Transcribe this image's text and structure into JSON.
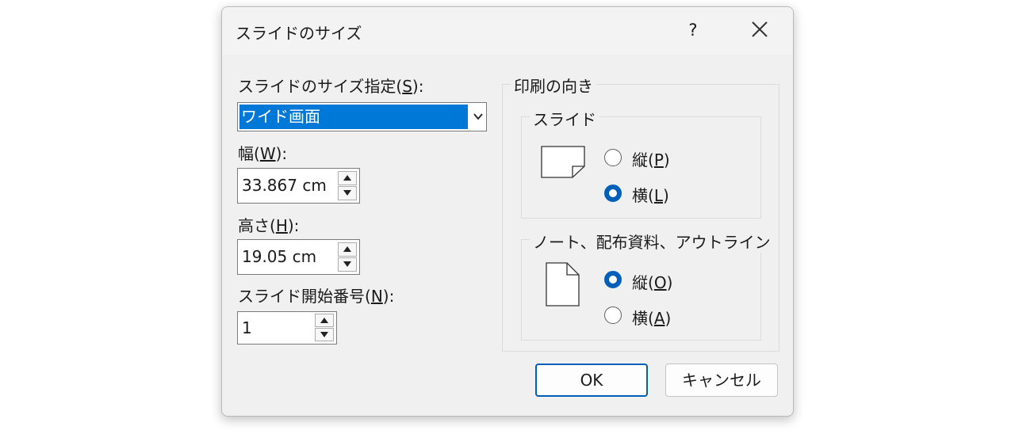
{
  "dialog": {
    "title": "スライドのサイズ",
    "help_label": "?"
  },
  "size": {
    "label_text": "スライドのサイズ指定(",
    "label_key": "S",
    "label_tail": "):",
    "selected": "ワイド画面"
  },
  "width": {
    "label_text": "幅(",
    "label_key": "W",
    "label_tail": "):",
    "value": "33.867 cm"
  },
  "height": {
    "label_text": "高さ(",
    "label_key": "H",
    "label_tail": "):",
    "value": "19.05 cm"
  },
  "start_number": {
    "label_text": "スライド開始番号(",
    "label_key": "N",
    "label_tail": "):",
    "value": "1"
  },
  "orientation": {
    "title": "印刷の向き",
    "slides": {
      "title": "スライド",
      "portrait": {
        "text": "縦(",
        "key": "P",
        "tail": ")",
        "checked": false
      },
      "landscape": {
        "text": "横(",
        "key": "L",
        "tail": ")",
        "checked": true
      }
    },
    "notes": {
      "title": "ノート、配布資料、アウトライン",
      "portrait": {
        "text": "縦(",
        "key": "O",
        "tail": ")",
        "checked": true
      },
      "landscape": {
        "text": "横(",
        "key": "A",
        "tail": ")",
        "checked": false
      }
    }
  },
  "buttons": {
    "ok": "OK",
    "cancel": "キャンセル"
  },
  "colors": {
    "accent": "#005fb8",
    "selection": "#0078d7"
  }
}
